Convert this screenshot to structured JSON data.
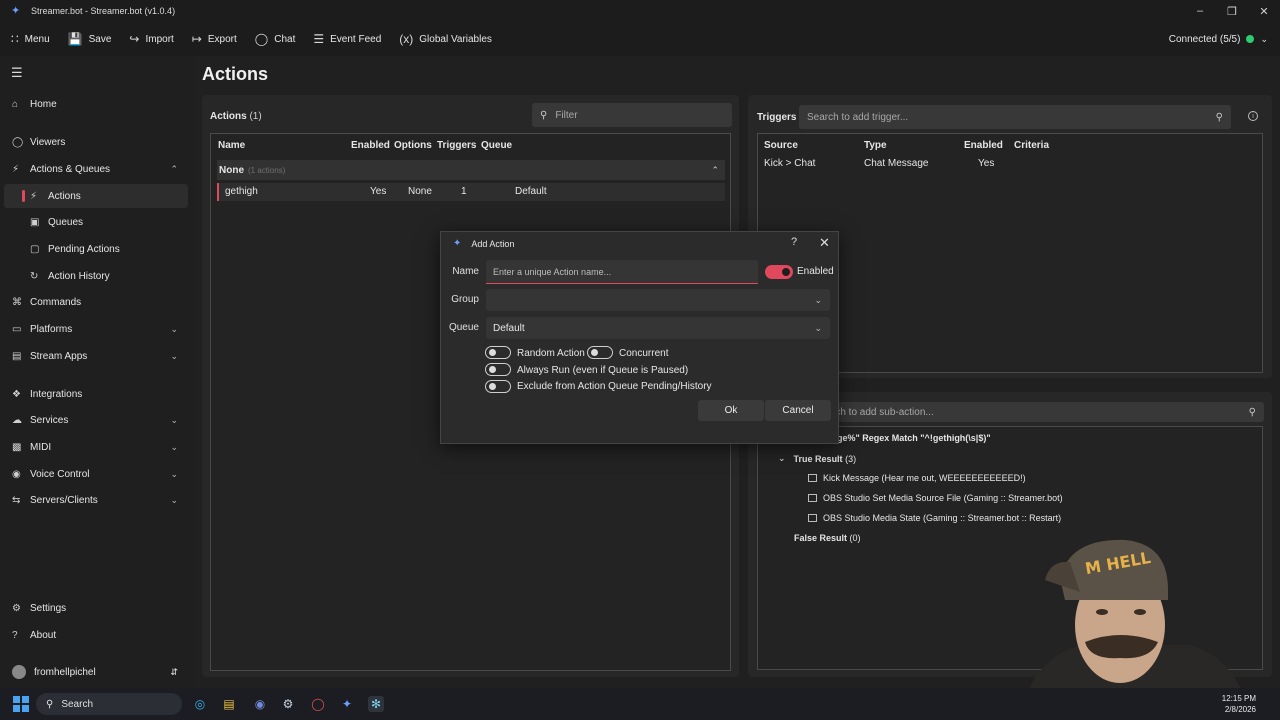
{
  "window": {
    "title": "Streamer.bot - Streamer.bot (v1.0.4)"
  },
  "toolbar": {
    "menu": "Menu",
    "save": "Save",
    "import": "Import",
    "export": "Export",
    "chat": "Chat",
    "event_feed": "Event Feed",
    "global_variables": "Global Variables",
    "connection": "Connected (5/5)"
  },
  "sidebar": {
    "items": [
      {
        "label": "Home"
      },
      {
        "label": "Viewers"
      },
      {
        "label": "Actions & Queues"
      },
      {
        "label": "Actions"
      },
      {
        "label": "Queues"
      },
      {
        "label": "Pending Actions"
      },
      {
        "label": "Action History"
      },
      {
        "label": "Commands"
      },
      {
        "label": "Platforms"
      },
      {
        "label": "Stream Apps"
      },
      {
        "label": "Integrations"
      },
      {
        "label": "Services"
      },
      {
        "label": "MIDI"
      },
      {
        "label": "Voice Control"
      },
      {
        "label": "Servers/Clients"
      },
      {
        "label": "Settings"
      },
      {
        "label": "About"
      }
    ],
    "user": "fromhellpichel"
  },
  "page": {
    "title": "Actions"
  },
  "actions_panel": {
    "heading": "Actions",
    "count": "(1)",
    "filter_placeholder": "Filter",
    "columns": [
      "Name",
      "Enabled",
      "Options",
      "Triggers",
      "Queue"
    ],
    "group": {
      "name": "None",
      "sub": "(1 actions)"
    },
    "rows": [
      {
        "name": "gethigh",
        "enabled": "Yes",
        "options": "None",
        "triggers": "1",
        "queue": "Default"
      }
    ]
  },
  "triggers_panel": {
    "heading": "Triggers",
    "search_placeholder": "Search to add trigger...",
    "columns": [
      "Source",
      "Type",
      "Enabled",
      "Criteria"
    ],
    "rows": [
      {
        "source": "Kick > Chat",
        "type": "Chat Message",
        "enabled": "Yes",
        "criteria": ""
      }
    ]
  },
  "subactions_panel": {
    "search_placeholder": "rch to add sub-action...",
    "condition": "age%\" Regex Match \"^!gethigh(\\s|$)\"",
    "true_result": "True Result",
    "true_count": "(3)",
    "items": [
      "Kick Message (Hear me out, WEEEEEEEEEEED!)",
      "OBS Studio Set Media Source File (Gaming :: Streamer.bot)",
      "OBS Studio Media State (Gaming :: Streamer.bot :: Restart)"
    ],
    "false_result": "False Result",
    "false_count": "(0)"
  },
  "dialog": {
    "title": "Add Action",
    "name_label": "Name",
    "name_placeholder": "Enter a unique Action name...",
    "enabled_label": "Enabled",
    "group_label": "Group",
    "group_value": "",
    "queue_label": "Queue",
    "queue_value": "Default",
    "random_action": "Random Action",
    "concurrent": "Concurrent",
    "always_run": "Always Run (even if Queue is Paused)",
    "exclude": "Exclude from Action Queue Pending/History",
    "ok": "Ok",
    "cancel": "Cancel"
  },
  "taskbar": {
    "search": "Search",
    "time": "12:15 PM",
    "date": "2/8/2026"
  },
  "colors": {
    "accent": "#e0495c",
    "connected": "#2ecc71",
    "background": "#202020"
  }
}
